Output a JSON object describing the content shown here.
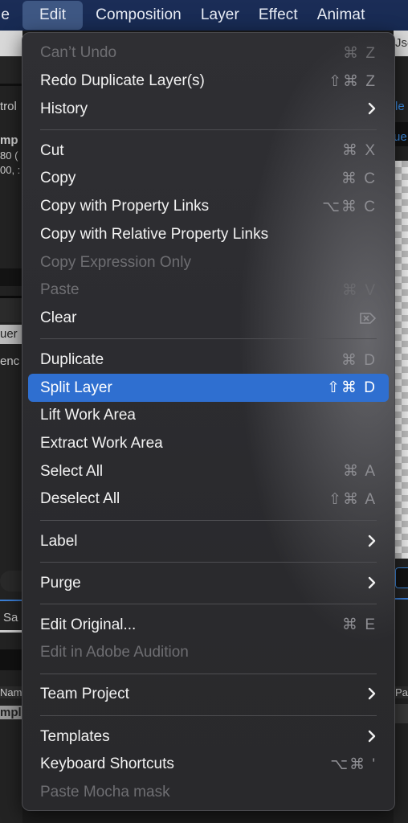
{
  "menubar": {
    "items": [
      {
        "label": "le"
      },
      {
        "label": "Edit",
        "active": true
      },
      {
        "label": "Composition"
      },
      {
        "label": "Layer"
      },
      {
        "label": "Effect"
      },
      {
        "label": "Animat"
      }
    ]
  },
  "background": {
    "left_texts": [
      "trol",
      "mp",
      "80 (",
      "00, :",
      "uer",
      "enc",
      "Sa",
      "Nam",
      "mpl"
    ],
    "right_texts": [
      "Jse",
      "le",
      "ue",
      "Pa"
    ]
  },
  "edit_menu": {
    "items": [
      {
        "type": "item",
        "label": "Can’t Undo",
        "shortcut": "⌘ Z",
        "disabled": true
      },
      {
        "type": "item",
        "label": "Redo Duplicate Layer(s)",
        "shortcut": "⇧⌘ Z"
      },
      {
        "type": "item",
        "label": "History",
        "submenu": true
      },
      {
        "type": "separator"
      },
      {
        "type": "item",
        "label": "Cut",
        "shortcut": "⌘ X"
      },
      {
        "type": "item",
        "label": "Copy",
        "shortcut": "⌘ C"
      },
      {
        "type": "item",
        "label": "Copy with Property Links",
        "shortcut": "⌥⌘ C"
      },
      {
        "type": "item",
        "label": "Copy with Relative Property Links"
      },
      {
        "type": "item",
        "label": "Copy Expression Only",
        "disabled": true
      },
      {
        "type": "item",
        "label": "Paste",
        "shortcut": "⌘ V",
        "disabled": true
      },
      {
        "type": "item",
        "label": "Clear",
        "shortcut_icon": "delete-forward-icon"
      },
      {
        "type": "separator"
      },
      {
        "type": "item",
        "label": "Duplicate",
        "shortcut": "⌘ D"
      },
      {
        "type": "item",
        "label": "Split Layer",
        "shortcut": "⇧⌘ D",
        "highlighted": true
      },
      {
        "type": "item",
        "label": "Lift Work Area"
      },
      {
        "type": "item",
        "label": "Extract Work Area"
      },
      {
        "type": "item",
        "label": "Select All",
        "shortcut": "⌘ A"
      },
      {
        "type": "item",
        "label": "Deselect All",
        "shortcut": "⇧⌘ A"
      },
      {
        "type": "separator"
      },
      {
        "type": "item",
        "label": "Label",
        "submenu": true
      },
      {
        "type": "separator"
      },
      {
        "type": "item",
        "label": "Purge",
        "submenu": true
      },
      {
        "type": "separator"
      },
      {
        "type": "item",
        "label": "Edit Original...",
        "shortcut": "⌘ E"
      },
      {
        "type": "item",
        "label": "Edit in Adobe Audition",
        "disabled": true
      },
      {
        "type": "separator"
      },
      {
        "type": "item",
        "label": "Team Project",
        "submenu": true
      },
      {
        "type": "separator"
      },
      {
        "type": "item",
        "label": "Templates",
        "submenu": true
      },
      {
        "type": "item",
        "label": "Keyboard Shortcuts",
        "shortcut": "⌥⌘ '"
      },
      {
        "type": "item",
        "label": "Paste Mocha mask",
        "disabled": true
      }
    ]
  },
  "colors": {
    "menubar": "#1b2d57",
    "menubar_active": "#3e5783",
    "highlight": "#2f6fd0"
  }
}
